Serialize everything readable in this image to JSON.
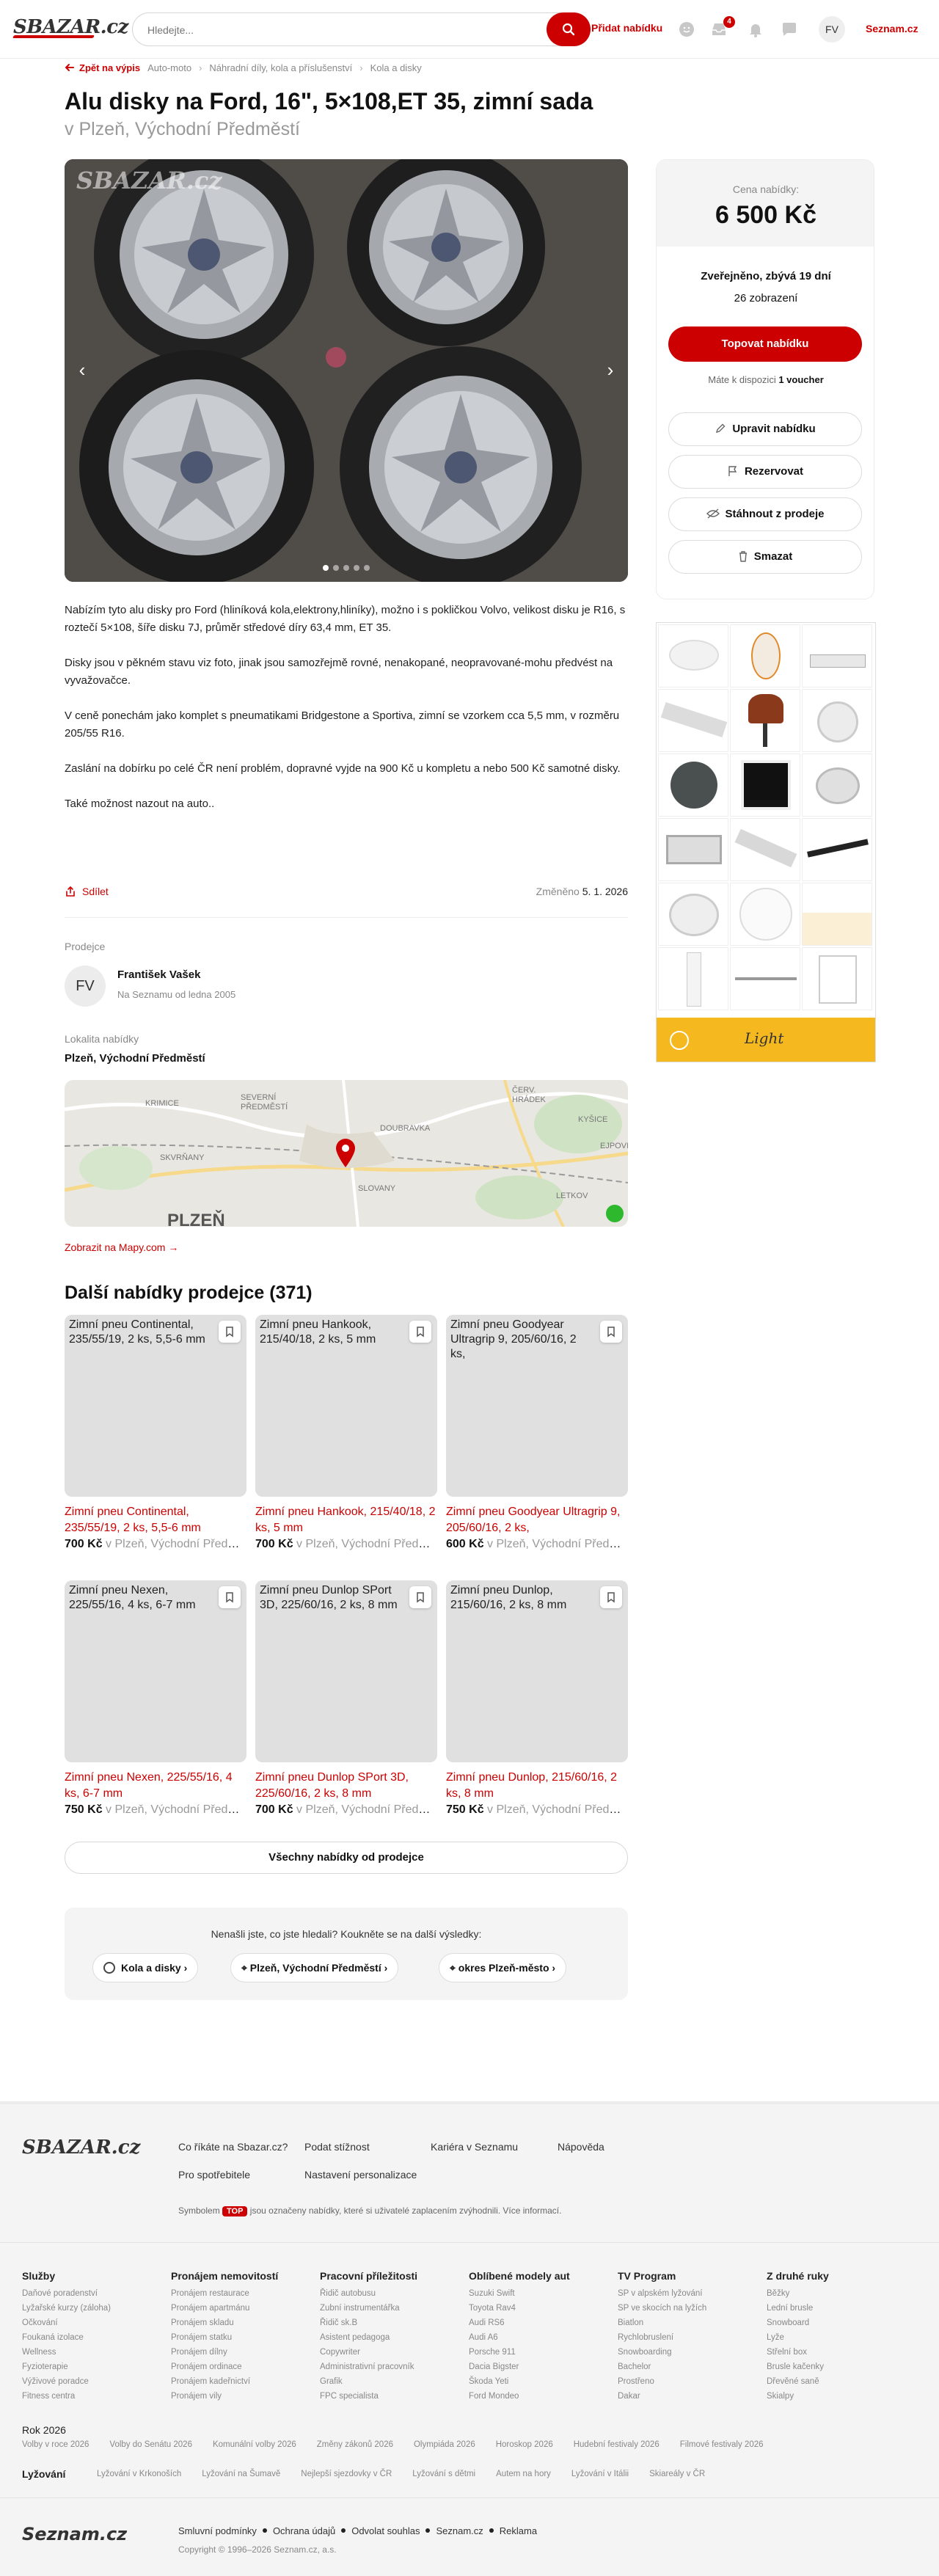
{
  "header": {
    "logo": "SBAZAR.cz",
    "search_placeholder": "Hledejte...",
    "add_listing": "Přidat nabídku",
    "notif_count": "4",
    "user_initials": "FV",
    "seznam_link": "Seznam.cz"
  },
  "breadcrumb": {
    "back": "Zpět na výpis",
    "items": [
      "Auto-moto",
      "Náhradní díly, kola a příslušenství",
      "Kola a disky"
    ]
  },
  "listing": {
    "title": "Alu disky na Ford, 16\", 5×108,ET 35, zimní sada",
    "location": "v Plzeň, Východní Předměstí",
    "gallery_watermark": "SBAZAR.cz",
    "description": [
      "Nabízím tyto alu disky pro Ford (hliníková kola,elektrony,hliníky), možno i s pokličkou Volvo, velikost disku je R16, s roztečí 5×108, šíře disku 7J, průměr středové díry 63,4 mm, ET 35.",
      "Disky jsou v pěkném stavu viz foto, jinak jsou samozřejmě rovné, nenakopané, neopravované-mohu předvést na vyvažovačce.",
      "V ceně ponechám jako komplet s pneumatikami Bridgestone a Sportiva, zimní se vzorkem cca 5,5 mm, v rozměru 205/55 R16.",
      "Zaslání na dobírku po celé ČR není problém, dopravné vyjde na 900 Kč u kompletu a nebo 500 Kč samotné disky.",
      "Také možnost nazout na auto.."
    ],
    "share": "Sdílet",
    "changed_label": "Změněno",
    "changed_date": "5. 1. 2026"
  },
  "seller": {
    "section_label": "Prodejce",
    "initials": "FV",
    "name": "František Vašek",
    "since": "Na Seznamu od ledna 2005"
  },
  "locality": {
    "section_label": "Lokalita nabídky",
    "value": "Plzeň, Východní Předměstí",
    "map_link": "Zobrazit na Mapy.com →",
    "map_labels": [
      "KRIMICE",
      "SEVERNÍ PŘEDMĚSTÍ",
      "ČERV. HRÁDEK",
      "DOUBRAVKA",
      "SKVRŇANY",
      "SLOVANY",
      "KYŠICE",
      "EJPOVICE",
      "LETKOV",
      "PLZEŇ"
    ]
  },
  "more_offers": {
    "title": "Další nabídky prodejce (371)",
    "cards": [
      {
        "alt": "Zimní pneu Continental, 235/55/19, 2 ks, 5,5-6 mm",
        "title": "Zimní pneu Continental, 235/55/19, 2 ks, 5,5-6 mm",
        "price": "700 Kč",
        "place": "v Plzeň, Východní Předměstí"
      },
      {
        "alt": "Zimní pneu Hankook, 215/40/18, 2 ks, 5 mm",
        "title": "Zimní pneu Hankook, 215/40/18, 2 ks, 5 mm",
        "price": "700 Kč",
        "place": "v Plzeň, Východní Předměstí"
      },
      {
        "alt": "Zimní pneu Goodyear Ultragrip 9, 205/60/16, 2 ks,",
        "title": "Zimní pneu Goodyear Ultragrip 9, 205/60/16, 2 ks,",
        "price": "600 Kč",
        "place": "v Plzeň, Východní Předměstí"
      },
      {
        "alt": "Zimní pneu Nexen, 225/55/16, 4 ks, 6-7 mm",
        "title": "Zimní pneu Nexen, 225/55/16, 4 ks, 6-7 mm",
        "price": "750 Kč",
        "place": "v Plzeň, Východní Předměstí"
      },
      {
        "alt": "Zimní pneu Dunlop SPort 3D, 225/60/16, 2 ks, 8 mm",
        "title": "Zimní pneu Dunlop SPort 3D, 225/60/16, 2 ks, 8 mm",
        "price": "700 Kč",
        "place": "v Plzeň, Východní Předměstí"
      },
      {
        "alt": "Zimní pneu Dunlop, 215/60/16, 2 ks, 8 mm",
        "title": "Zimní pneu Dunlop, 215/60/16, 2 ks, 8 mm",
        "price": "750 Kč",
        "place": "v Plzeň, Východní Předměstí"
      }
    ],
    "all_button": "Všechny nabídky od prodejce"
  },
  "not_found": {
    "text": "Nenašli jste, co jste hledali? Koukněte se na další výsledky:",
    "chips": [
      "Kola a disky",
      "Plzeň, Východní Předměstí",
      "okres Plzeň-město"
    ]
  },
  "sidebar": {
    "price_label": "Cena nabídky:",
    "price": "6 500 Kč",
    "published": "Zveřejněno, zbývá 19 dní",
    "views": "26 zobrazení",
    "top_button": "Topovat nabídku",
    "voucher_prefix": "Máte k dispozici",
    "voucher_value": "1 voucher",
    "edit": "Upravit nabídku",
    "reserve": "Rezervovat",
    "withdraw": "Stáhnout z prodeje",
    "delete": "Smazat"
  },
  "ad": {
    "brand": "Light"
  },
  "footer": {
    "logo": "SBAZAR.cz",
    "links_row1": [
      "Co říkáte na Sbazar.cz?",
      "Podat stížnost",
      "Kariéra v Seznamu",
      "Nápověda"
    ],
    "links_row2": [
      "Pro spotřebitele",
      "Nastavení personalizace"
    ],
    "top_note_pre": "Symbolem",
    "top_badge": "TOP",
    "top_note_post": "jsou označeny nabídky, které si uživatelé zaplacením zvýhodnili. Více informací.",
    "columns": [
      {
        "title": "Služby",
        "items": [
          "Daňové poradenství",
          "Lyžařské kurzy (záloha)",
          "Očkování",
          "Foukaná izolace",
          "Wellness",
          "Fyzioterapie",
          "Výživové poradce",
          "Fitness centra"
        ]
      },
      {
        "title": "Pronájem nemovitostí",
        "items": [
          "Pronájem restaurace",
          "Pronájem apartmánu",
          "Pronájem skladu",
          "Pronájem statku",
          "Pronájem dílny",
          "Pronájem ordinace",
          "Pronájem kadeřnictví",
          "Pronájem vily"
        ]
      },
      {
        "title": "Pracovní příležitosti",
        "items": [
          "Řidič autobusu",
          "Zubní instrumentářka",
          "Řidič sk.B",
          "Asistent pedagoga",
          "Copywriter",
          "Administrativní pracovník",
          "Grafik",
          "FPC specialista"
        ]
      },
      {
        "title": "Oblíbené modely aut",
        "items": [
          "Suzuki Swift",
          "Toyota Rav4",
          "Audi RS6",
          "Audi A6",
          "Porsche 911",
          "Dacia Bigster",
          "Škoda Yeti",
          "Ford Mondeo"
        ]
      },
      {
        "title": "TV Program",
        "items": [
          "SP v alpském lyžování",
          "SP ve skocích na lyžích",
          "Biatlon",
          "Rychlobruslení",
          "Snowboarding",
          "Bachelor",
          "Prostřeno",
          "Dakar"
        ]
      },
      {
        "title": "Z druhé ruky",
        "items": [
          "Běžky",
          "Lední brusle",
          "Snowboard",
          "Lyže",
          "Střelní box",
          "Brusle kačenky",
          "Dřevěné saně",
          "Skialpy"
        ]
      }
    ],
    "year_title": "Rok 2026",
    "year_items": [
      "Volby v roce 2026",
      "Volby do Senátu 2026",
      "Komunální volby 2026",
      "Změny zákonů 2026",
      "Olympiáda 2026",
      "Horoskop 2026",
      "Hudební festivaly 2026",
      "Filmové festivaly 2026"
    ],
    "ski_title": "Lyžování",
    "ski_items": [
      "Lyžování v Krkonoších",
      "Lyžování na Šumavě",
      "Nejlepší sjezdovky v ČR",
      "Lyžování s dětmi",
      "Autem na hory",
      "Lyžování v Itálii",
      "Skiareály v ČR"
    ],
    "seznam_logo": "Seznam.cz",
    "legal": [
      "Smluvní podmínky",
      "Ochrana údajů",
      "Odvolat souhlas",
      "Seznam.cz",
      "Reklama"
    ],
    "copyright": "Copyright © 1996–2026 Seznam.cz, a.s."
  }
}
